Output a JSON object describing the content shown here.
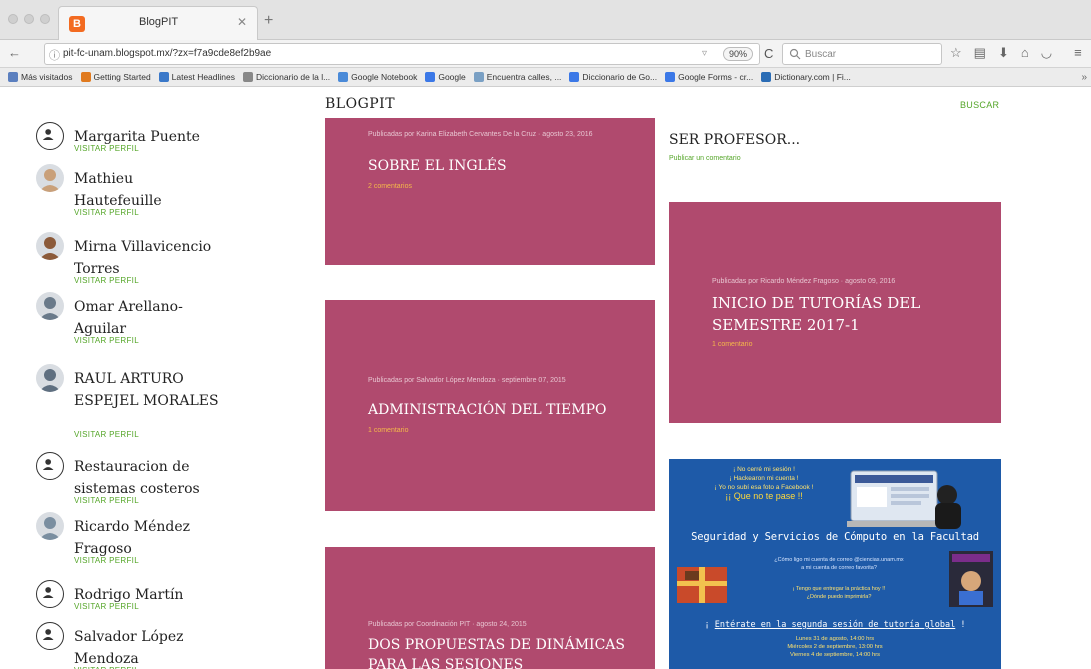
{
  "browser": {
    "tab_title": "BlogPIT",
    "tab_favicon": "B",
    "url": "pit-fc-unam.blogspot.mx/?zx=f7a9cde8ef2b9ae",
    "zoom": "90%",
    "search_placeholder": "Buscar",
    "bookmarks": [
      {
        "label": "Más visitados",
        "color": "#5b7fbf"
      },
      {
        "label": "Getting Started",
        "color": "#e07a1f"
      },
      {
        "label": "Latest Headlines",
        "color": "#3a78c9"
      },
      {
        "label": "Diccionario de la l...",
        "color": "#888888"
      },
      {
        "label": "Google Notebook",
        "color": "#4a8ad8"
      },
      {
        "label": "Google",
        "color": "#3b78e7"
      },
      {
        "label": "Encuentra calles, ...",
        "color": "#7aa0c4"
      },
      {
        "label": "Diccionario de Go...",
        "color": "#3b78e7"
      },
      {
        "label": "Google Forms - cr...",
        "color": "#3b78e7"
      },
      {
        "label": "Dictionary.com | Fi...",
        "color": "#2a6cb5"
      }
    ]
  },
  "blog": {
    "title": "BLOGPIT",
    "search_label": "BUSCAR"
  },
  "sidebar": {
    "visit_label": "VISITAR PERFIL",
    "contributors": [
      {
        "name": "Margarita Puente",
        "avatar": "default"
      },
      {
        "name": "Mathieu Hautefeuille",
        "avatar": "photo"
      },
      {
        "name": "Mirna Villavicencio Torres",
        "avatar": "photo"
      },
      {
        "name": "Omar Arellano-Aguilar",
        "avatar": "photo"
      },
      {
        "name": "RAUL ARTURO ESPEJEL MORALES",
        "avatar": "photo"
      },
      {
        "name": "Restauracion de sistemas costeros",
        "avatar": "default"
      },
      {
        "name": "Ricardo Méndez Fragoso",
        "avatar": "photo"
      },
      {
        "name": "Rodrigo Martín",
        "avatar": "default"
      },
      {
        "name": "Salvador López Mendoza",
        "avatar": "default"
      }
    ]
  },
  "posts": [
    {
      "meta": "Publicadas por Karina Elizabeth Cervantes De la Cruz · agosto 23, 2016",
      "title": "SOBRE EL INGLÉS",
      "comments": "2 comentarios"
    },
    {
      "meta": "Publicadas por Salvador López Mendoza · septiembre 07, 2015",
      "title": "ADMINISTRACIÓN DEL TIEMPO",
      "comments": "1 comentario"
    },
    {
      "meta": "Publicadas por Coordinación PIT · agosto 24, 2015",
      "title": "DOS PROPUESTAS DE DINÁMICAS PARA LAS SESIONES",
      "comments": ""
    },
    {
      "meta": "Publicadas por Ricardo Méndez Fragoso · agosto 09, 2016",
      "title": "INICIO DE TUTORÍAS DEL SEMESTRE 2017-1",
      "comments": "1 comentario"
    }
  ],
  "plain_post": {
    "title": "SER PROFESOR...",
    "comment": "Publicar un comentario"
  },
  "flyer": {
    "top_lines": [
      "¡ No cerré mi sesión !",
      "¡ Hackearon mi cuenta !",
      "¡ Yo no subí esa foto a Facebook !"
    ],
    "top_big": "¡¡ Que no te pase !!",
    "headline": "Seguridad y Servicios de Cómputo en la Facultad",
    "mid_lines": [
      "¿Cómo ligo mi cuenta de correo @ciencias.unam.mx",
      "a mi cuenta de correo favorita?"
    ],
    "mid2_lines": [
      "¡ Tengo que entregar la práctica hoy !!",
      "¿Dónde puedo imprimirla?"
    ],
    "cta_pre": "¡ ",
    "cta_link": "Entérate en la segunda sesión de tutoría global",
    "cta_post": " !",
    "dates": [
      "Lunes 31 de agosto, 14:00 hrs",
      "Miércoles 2 de septiembre, 13:00 hrs",
      "Viernes 4 de septiembre, 14:00 hrs"
    ]
  }
}
